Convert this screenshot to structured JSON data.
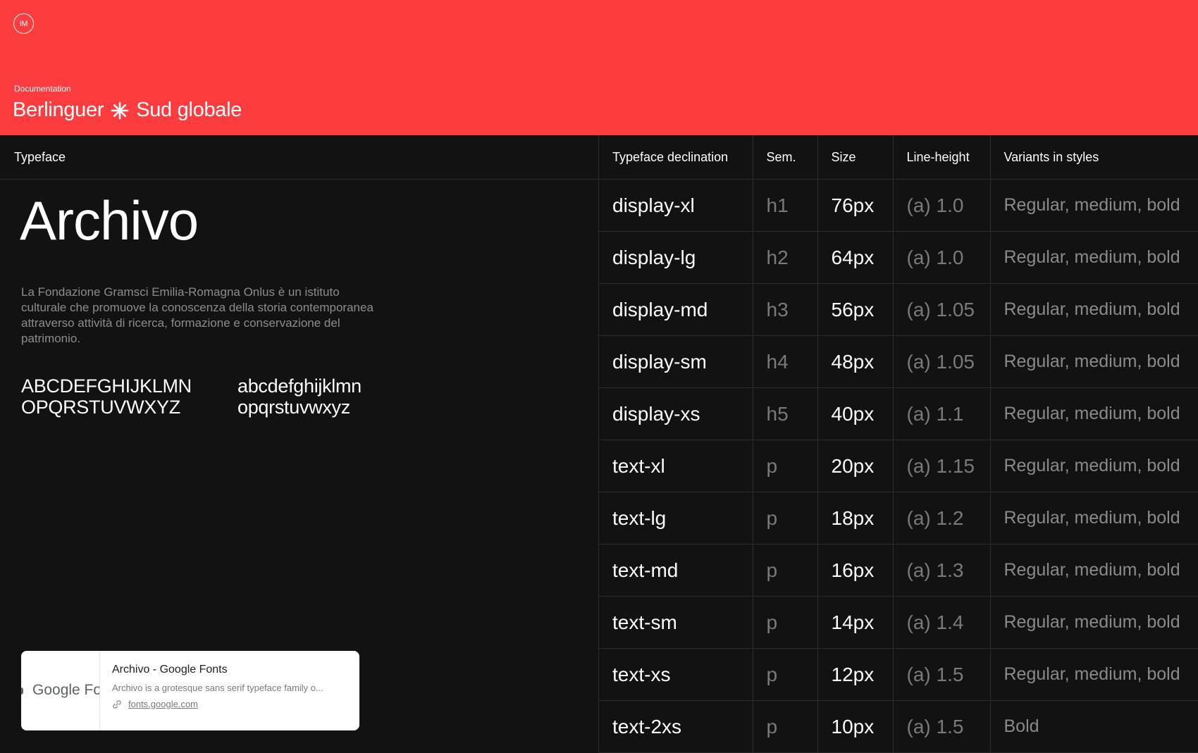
{
  "header": {
    "logo_text": "IM",
    "eyebrow": "Documentation",
    "title_left": "Berlinguer",
    "title_right": "Sud globale",
    "background": "#fd3c3f"
  },
  "typeface_panel": {
    "heading": "Typeface",
    "name": "Archivo",
    "description": "La Fondazione Gramsci Emilia-Romagna Onlus è un istituto culturale che promuove la conoscenza della storia contemporanea attraverso attività di ricerca, formazione e conservazione del patrimonio.",
    "uppercase_line1": "ABCDEFGHIJKLMN",
    "uppercase_line2": "OPQRSTUVWXYZ",
    "lowercase_line1": "abcdefghijklmn",
    "lowercase_line2": "opqrstuvwxyz"
  },
  "link_preview": {
    "thumb_text": "Google Fonts",
    "title": "Archivo - Google Fonts",
    "description": "Archivo is a grotesque sans serif typeface family o...",
    "url": "fonts.google.com"
  },
  "table": {
    "columns": [
      "Typeface declination",
      "Sem.",
      "Size",
      "Line-height",
      "Variants in styles"
    ],
    "rows": [
      {
        "name": "display-xl",
        "sem": "h1",
        "size": "76px",
        "line_height": "(a) 1.0",
        "variants": "Regular, medium, bold"
      },
      {
        "name": "display-lg",
        "sem": "h2",
        "size": "64px",
        "line_height": "(a) 1.0",
        "variants": "Regular, medium, bold"
      },
      {
        "name": "display-md",
        "sem": "h3",
        "size": "56px",
        "line_height": "(a) 1.05",
        "variants": "Regular, medium, bold"
      },
      {
        "name": "display-sm",
        "sem": "h4",
        "size": "48px",
        "line_height": "(a) 1.05",
        "variants": "Regular, medium, bold"
      },
      {
        "name": "display-xs",
        "sem": "h5",
        "size": "40px",
        "line_height": "(a) 1.1",
        "variants": "Regular, medium, bold"
      },
      {
        "name": "text-xl",
        "sem": "p",
        "size": "20px",
        "line_height": "(a) 1.15",
        "variants": "Regular, medium, bold"
      },
      {
        "name": "text-lg",
        "sem": "p",
        "size": "18px",
        "line_height": "(a) 1.2",
        "variants": "Regular, medium, bold"
      },
      {
        "name": "text-md",
        "sem": "p",
        "size": "16px",
        "line_height": "(a) 1.3",
        "variants": "Regular, medium, bold"
      },
      {
        "name": "text-sm",
        "sem": "p",
        "size": "14px",
        "line_height": "(a) 1.4",
        "variants": "Regular, medium, bold"
      },
      {
        "name": "text-xs",
        "sem": "p",
        "size": "12px",
        "line_height": "(a) 1.5",
        "variants": "Regular, medium, bold"
      },
      {
        "name": "text-2xs",
        "sem": "p",
        "size": "10px",
        "line_height": "(a) 1.5",
        "variants": "Bold"
      }
    ]
  }
}
